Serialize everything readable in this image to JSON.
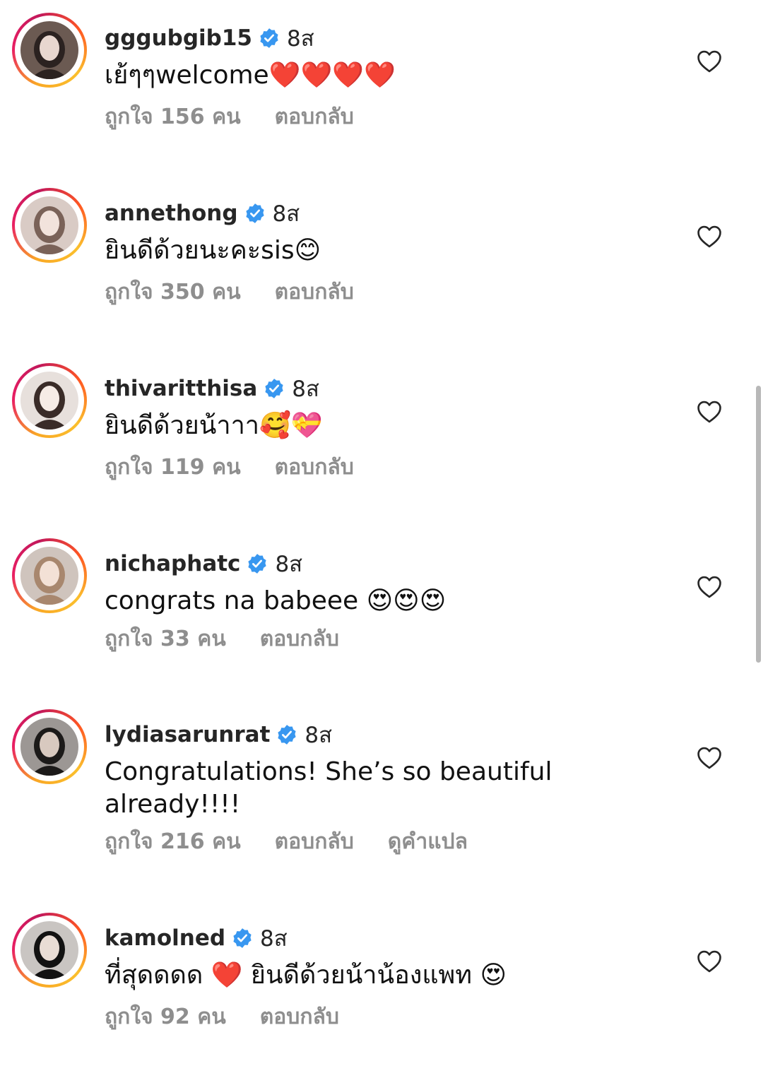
{
  "colors": {
    "verified": "#3897f0",
    "muted": "#8e8e8e",
    "heart_outline": "#262626",
    "ring_start": "#f9a825",
    "ring_end": "#e91e63"
  },
  "icons": {
    "verified": "verified-badge-icon",
    "like": "heart-outline-icon"
  },
  "comments": [
    {
      "username": "gggubgib15",
      "verified": true,
      "time": "8ส",
      "text": "เย้ๆๆwelcome❤️❤️❤️❤️",
      "likes_label": "ถูกใจ 156 คน",
      "reply_label": "ตอบกลับ"
    },
    {
      "username": "annethong",
      "verified": true,
      "time": "8ส",
      "text": "ยินดีด้วยนะคะsis😊",
      "likes_label": "ถูกใจ 350 คน",
      "reply_label": "ตอบกลับ"
    },
    {
      "username": "thivaritthisa",
      "verified": true,
      "time": "8ส",
      "text": "ยินดีด้วยน้าาา🥰💝",
      "likes_label": "ถูกใจ 119 คน",
      "reply_label": "ตอบกลับ"
    },
    {
      "username": "nichaphatc",
      "verified": true,
      "time": "8ส",
      "text": "congrats na babeee 😍😍😍",
      "likes_label": "ถูกใจ 33 คน",
      "reply_label": "ตอบกลับ"
    },
    {
      "username": "lydiasarunrat",
      "verified": true,
      "time": "8ส",
      "text": "Congratulations! She’s so beautiful already!!!!",
      "likes_label": "ถูกใจ 216 คน",
      "reply_label": "ตอบกลับ",
      "translate_label": "ดูคำแปล"
    },
    {
      "username": "kamolned",
      "verified": true,
      "time": "8ส",
      "text": "ที่สุดดดด ❤️ ยินดีด้วยน้าน้องแพท 😍",
      "likes_label": "ถูกใจ 92 คน",
      "reply_label": "ตอบกลับ"
    }
  ]
}
